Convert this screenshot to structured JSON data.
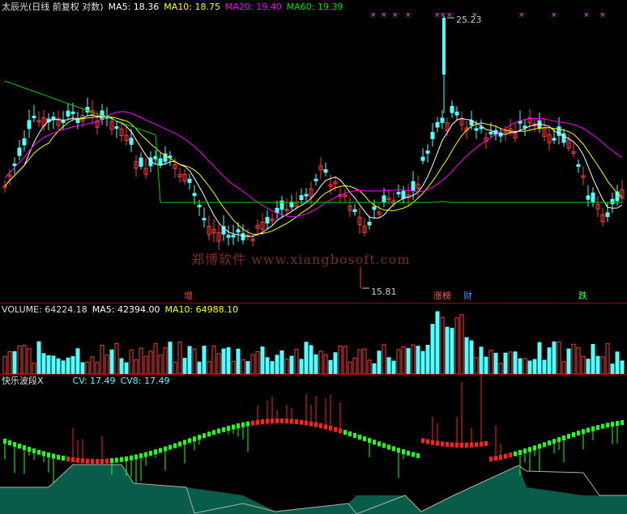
{
  "main": {
    "title": "太辰光(日线 前复权 对数)",
    "ma5_label": "MA5: 18.36",
    "ma10_label": "MA10: 18.75",
    "ma20_label": "MA20: 19.40",
    "ma60_label": "MA60: 19.39",
    "high_label": "25.23",
    "low_label": "15.81",
    "watermark": "郑博软件 www.xiangbosoft.com",
    "events": [
      {
        "label": "增",
        "color": "#ff4040"
      },
      {
        "label": "涨榜",
        "color": "#ff6060"
      },
      {
        "label": "财",
        "color": "#4a8cff"
      },
      {
        "label": "跌",
        "color": "#40ff40"
      }
    ],
    "colors": {
      "up": "#ff3b3b",
      "down": "#54ffff",
      "ma5": "#ffffff",
      "ma10": "#ffff00",
      "ma20": "#ff00ff",
      "ma60": "#00d000",
      "marker": "#ff50ff"
    }
  },
  "volume": {
    "volume_label": "VOLUME: 64224.18",
    "ma5_label": "MA5: 42394.00",
    "ma10_label": "MA10: 64988.10"
  },
  "indicator": {
    "title": "快乐波段X",
    "cv_label": "CV: 17.49",
    "cv8_label": "CV8: 17.49",
    "colors": {
      "up": "#ff2020",
      "down": "#20ff20",
      "band": "#0a6650"
    }
  }
}
